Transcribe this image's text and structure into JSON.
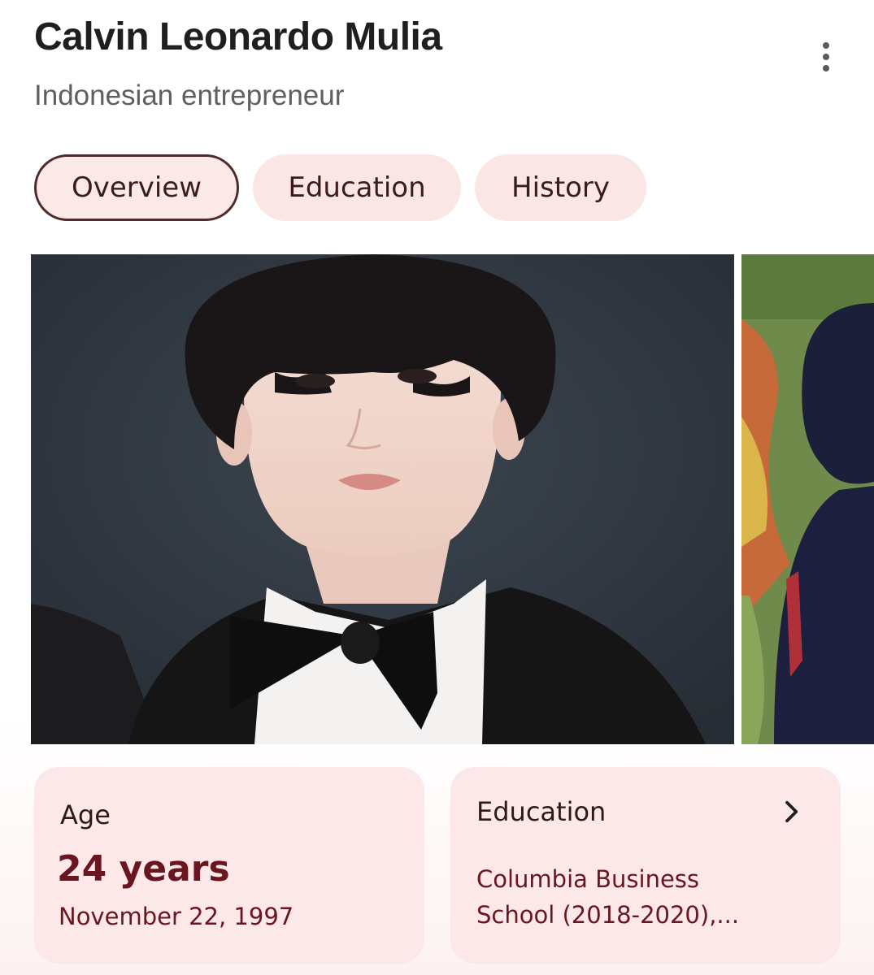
{
  "header": {
    "title": "Calvin Leonardo Mulia",
    "subtitle": "Indonesian entrepreneur",
    "more_icon": "more-vert-icon"
  },
  "tabs": [
    {
      "label": "Overview",
      "active": true
    },
    {
      "label": "Education",
      "active": false
    },
    {
      "label": "History",
      "active": false
    }
  ],
  "cards": {
    "age": {
      "label": "Age",
      "value": "24 years",
      "detail": "November 22, 1997"
    },
    "education": {
      "label": "Education",
      "line1": "Columbia Business",
      "line2": "School (2018-2020),...",
      "icon": "chevron-right-icon"
    }
  },
  "colors": {
    "chip_bg": "#fbe6e6",
    "chip_active_border": "#4e2a2a",
    "card_bg": "#fce8e8",
    "accent_text": "#6a1620"
  }
}
